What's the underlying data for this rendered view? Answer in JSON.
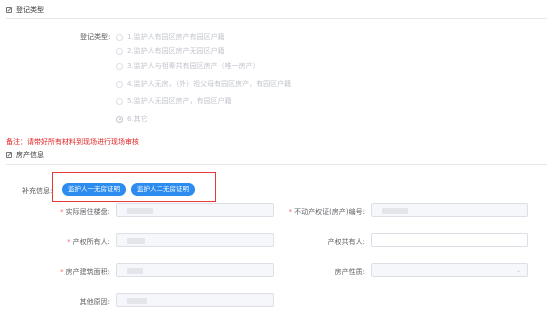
{
  "sections": {
    "registration_title": "登记类型",
    "housing_title": "房产信息"
  },
  "registration": {
    "label": "登记类型:",
    "options": [
      "1.监护人有园区房产有园区户籍",
      "2.监护人有园区房产无园区户籍",
      "3.监护人与祖辈共有园区房产（唯一房产）",
      "4.监护人无房，（外）祖父母有园区房产，有园区户籍",
      "5.监护人无园区房产，有园区户籍",
      "6.其它"
    ],
    "selected_index": 5
  },
  "note": "备注：请带好所有材料到现场进行现场审核",
  "supplement": {
    "label": "补充信息:",
    "buttons": [
      "监护人一无房证明",
      "监护人二无房证明"
    ]
  },
  "fields": {
    "residence_building": "实际居住楼盘:",
    "property_cert_no": "不动产权证(房产)编号:",
    "property_owner": "产权所有人:",
    "property_co_owner": "产权共有人:",
    "building_area": "房产建筑面积:",
    "property_nature": "房产性质:",
    "other_reason": "其他原因:"
  },
  "colors": {
    "accent": "#2d8cf0",
    "note_red": "#e02020",
    "highlight_border": "#e53935"
  }
}
